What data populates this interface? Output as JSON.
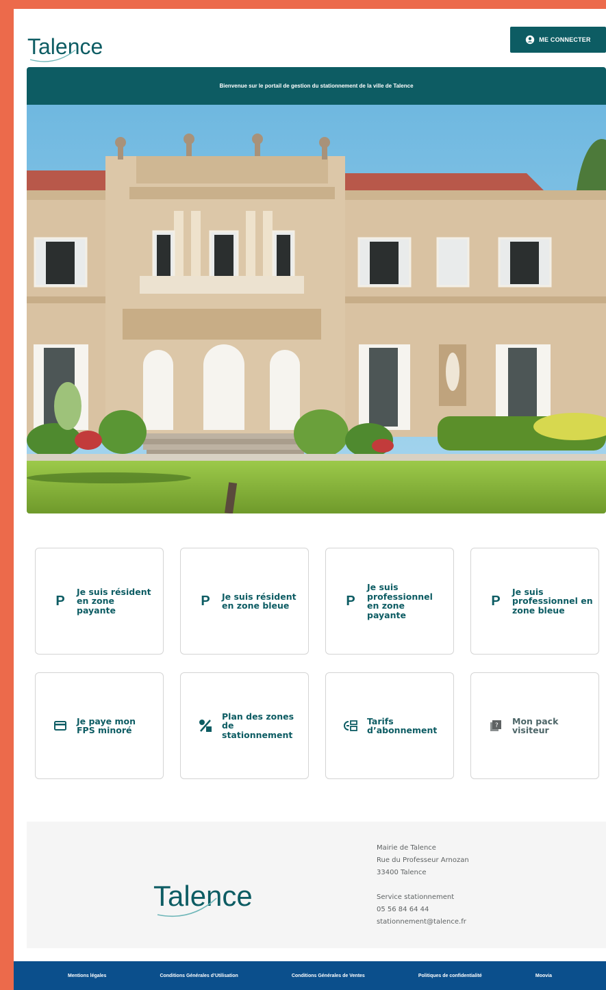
{
  "header": {
    "logo_text": "Talence",
    "connect_label": "ME CONNECTER"
  },
  "banner": {
    "text": "Bienvenue sur le portail de gestion du stationnement de la ville de Talence"
  },
  "tiles": [
    {
      "label": "Je suis résident en zone payante",
      "icon": "parking-icon"
    },
    {
      "label": "Je suis résident en zone bleue",
      "icon": "parking-icon"
    },
    {
      "label": "Je suis professionnel en zone payante",
      "icon": "parking-icon"
    },
    {
      "label": "Je suis professionnel en zone bleue",
      "icon": "parking-icon"
    },
    {
      "label": "Je paye mon FPS minoré",
      "icon": "credit-card-icon"
    },
    {
      "label": "Plan des zones de stationnement",
      "icon": "percent-shapes-icon"
    },
    {
      "label": "Tarifs d’abonnement",
      "icon": "price-list-icon"
    },
    {
      "label": "Mon pack visiteur",
      "icon": "help-book-icon"
    }
  ],
  "footer": {
    "logo_text": "Talence",
    "address": {
      "line1": "Mairie de Talence",
      "line2": "Rue du Professeur Arnozan",
      "line3": "33400 Talence"
    },
    "service": {
      "line1": "Service stationnement",
      "phone": "05 56 84 64 44",
      "email": "stationnement@talence.fr"
    },
    "links": [
      "Mentions légales",
      "Conditions Générales d’Utilisation",
      "Conditions Générales de Ventes",
      "Politiques de confidentialité",
      "Moovia"
    ]
  },
  "colors": {
    "brand": "#0d5c63",
    "footer_nav": "#0b4f8c",
    "outer_frame": "#ec6a4b"
  }
}
